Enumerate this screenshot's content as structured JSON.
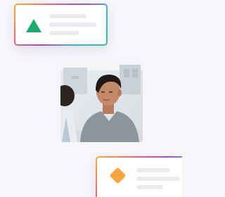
{
  "colors": {
    "background": "#f6f6fb",
    "card_border_gradient": [
      "#f2b233",
      "#f06b6b",
      "#a64ad2",
      "#3fb6dd",
      "#35c28a"
    ],
    "placeholder_bar": "#ebebef",
    "triangle_icon": "#1faa6b",
    "diamond_icon": "#f6a640"
  },
  "cards": [
    {
      "icon": "triangle-icon",
      "text_lines": 3
    },
    {
      "icon": "diamond-icon",
      "text_lines": 3
    }
  ],
  "photo": {
    "subject": "person-photo"
  }
}
